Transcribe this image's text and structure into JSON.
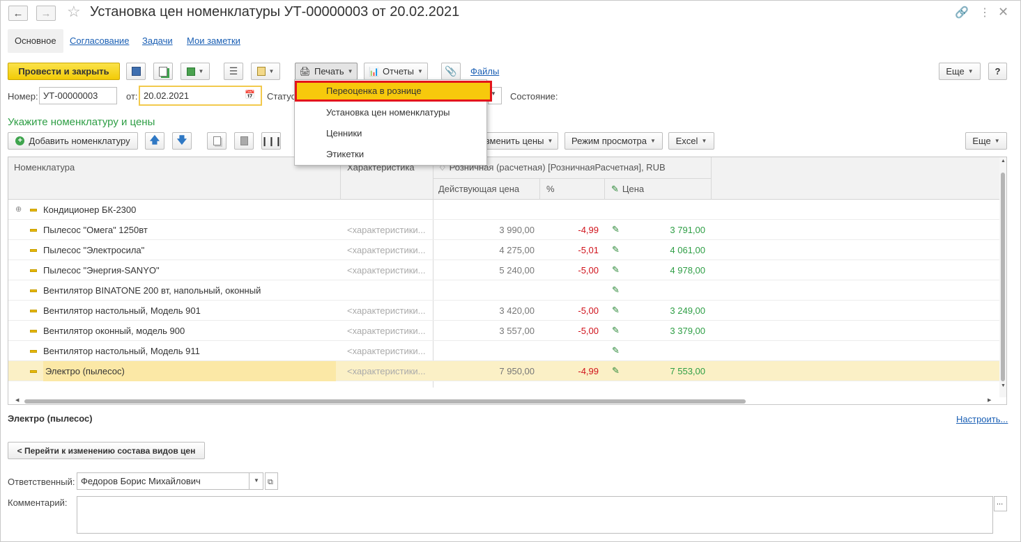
{
  "window": {
    "title": "Установка цен номенклатуры УТ-00000003 от 20.02.2021"
  },
  "tabs": [
    "Основное",
    "Согласование",
    "Задачи",
    "Мои заметки"
  ],
  "toolbar": {
    "post_close": "Провести и закрыть",
    "print": "Печать",
    "reports": "Отчеты",
    "files": "Файлы",
    "more": "Еще",
    "help": "?"
  },
  "header": {
    "number_label": "Номер:",
    "number_value": "УТ-00000003",
    "date_label": "от:",
    "date_value": "20.02.2021",
    "status_label": "Статус",
    "state_label": "Состояние:"
  },
  "print_menu": {
    "items": [
      "Переоценка в рознице",
      "Установка цен номенклатуры",
      "Ценники",
      "Этикетки"
    ]
  },
  "section": {
    "title": "Укажите номенклатуру и цены"
  },
  "table_toolbar": {
    "add": "Добавить номенклатуру",
    "change_prices": "зменить цены",
    "view_mode": "Режим просмотра",
    "excel": "Excel",
    "more": "Еще"
  },
  "grid": {
    "col_item": "Номенклатура",
    "col_char": "Характеристика",
    "col_group": "Розничная (расчетная) [РозничнаяРасчетная], RUB",
    "col_current": "Действующая цена",
    "col_pct": "%",
    "col_price": "Цена",
    "rows": [
      {
        "name": "Кондиционер БК-2300",
        "char": "",
        "current": "",
        "pct": "",
        "price": "",
        "pencil": false,
        "group": true
      },
      {
        "name": "Пылесос \"Омега\" 1250вт",
        "char": "<характеристики...",
        "current": "3 990,00",
        "pct": "-4,99",
        "price": "3 791,00",
        "pencil": true
      },
      {
        "name": "Пылесос \"Электросила\"",
        "char": "<характеристики...",
        "current": "4 275,00",
        "pct": "-5,01",
        "price": "4 061,00",
        "pencil": true
      },
      {
        "name": "Пылесос \"Энергия-SANYO\"",
        "char": "<характеристики...",
        "current": "5 240,00",
        "pct": "-5,00",
        "price": "4 978,00",
        "pencil": true
      },
      {
        "name": "Вентилятор BINATONE 200 вт, напольный, оконный",
        "char": "",
        "current": "",
        "pct": "",
        "price": "",
        "pencil": true
      },
      {
        "name": "Вентилятор настольный, Модель 901",
        "char": "<характеристики...",
        "current": "3 420,00",
        "pct": "-5,00",
        "price": "3 249,00",
        "pencil": true
      },
      {
        "name": "Вентилятор оконный, модель 900",
        "char": "<характеристики...",
        "current": "3 557,00",
        "pct": "-5,00",
        "price": "3 379,00",
        "pencil": true
      },
      {
        "name": "Вентилятор настольный, Модель 911",
        "char": "<характеристики...",
        "current": "",
        "pct": "",
        "price": "",
        "pencil": true
      },
      {
        "name": "Электро (пылесос)",
        "char": "<характеристики...",
        "current": "7 950,00",
        "pct": "-4,99",
        "price": "7 553,00",
        "pencil": true,
        "selected": true
      }
    ]
  },
  "footer": {
    "selected_name": "Электро (пылесос)",
    "configure": "Настроить...",
    "goto_button": "< Перейти к изменению состава видов цен",
    "responsible_label": "Ответственный:",
    "responsible_value": "Федоров Борис Михайлович",
    "comment_label": "Комментарий:"
  },
  "colors": {
    "accent_yellow": "#f2cb07",
    "green": "#2e9e45",
    "red": "#d0121b",
    "link": "#1a5fb4"
  }
}
